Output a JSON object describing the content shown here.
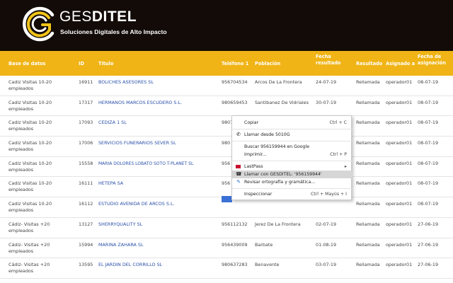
{
  "brand": {
    "name_light": "GES",
    "name_bold": "DITEL",
    "tagline": "Soluciones Digitales de Alto Impacto"
  },
  "columns": [
    {
      "label": "Base de datos"
    },
    {
      "label": "ID"
    },
    {
      "label": "Título"
    },
    {
      "label": "Teléfono 1"
    },
    {
      "label": "Población"
    },
    {
      "label": "Fecha resultado"
    },
    {
      "label": "Resultado"
    },
    {
      "label": "Asignado a"
    },
    {
      "label": "Fecha de asignación"
    }
  ],
  "rows": [
    {
      "base": "Cadiz Visitas 10-20 empleados",
      "id": "16911",
      "titulo": "BOLICHES ASESORES SL",
      "telefono": "956704534",
      "poblacion": "Arcos De La Frontera",
      "fecha_resultado": "24-07-19",
      "resultado": "Rellamada",
      "asignado": "operador01",
      "fecha_asignacion": "08-07-19"
    },
    {
      "base": "Cadiz Visitas 10-20 empleados",
      "id": "17317",
      "titulo": "HERMANOS MARCOS ESCUDERO S.L.",
      "telefono": "980659453",
      "poblacion": "Santibanez De Vidriales",
      "fecha_resultado": "30-07-19",
      "resultado": "Rellamada",
      "asignado": "operador01",
      "fecha_asignacion": "08-07-19"
    },
    {
      "base": "Cadiz Visitas 10-20 empleados",
      "id": "17093",
      "titulo": "CEDIZA 1 SL",
      "telefono": "9807",
      "poblacion": "",
      "fecha_resultado": "",
      "resultado": "Rellamada",
      "asignado": "operador01",
      "fecha_asignacion": "08-07-19"
    },
    {
      "base": "Cadiz Visitas 10-20 empleados",
      "id": "17006",
      "titulo": "SERVICIOS FUNERARIOS SEVER SL",
      "telefono": "980",
      "poblacion": "",
      "fecha_resultado": "",
      "resultado": "Rellamada",
      "asignado": "operador01",
      "fecha_asignacion": "08-07-19"
    },
    {
      "base": "Cadiz Visitas 10-20 empleados",
      "id": "15558",
      "titulo": "MARIA DOLORES LOBATO SOTO T-PLANET SL",
      "telefono": "956",
      "poblacion": "",
      "fecha_resultado": "",
      "resultado": "Rellamada",
      "asignado": "operador01",
      "fecha_asignacion": "08-07-19"
    },
    {
      "base": "Cadiz Visitas 10-20 empleados",
      "id": "16111",
      "titulo": "HETEPA SA",
      "telefono": "956",
      "poblacion": "",
      "fecha_resultado": "",
      "resultado": "Rellamada",
      "asignado": "operador01",
      "fecha_asignacion": "08-07-19"
    },
    {
      "base": "Cadiz Visitas 10-20 empleados",
      "id": "16112",
      "titulo": "ESTUDIO AVENIDA DE ARCOS S.L.",
      "telefono": "956",
      "poblacion": "",
      "fecha_resultado": "",
      "resultado": "Rellamada",
      "asignado": "operador01",
      "fecha_asignacion": "08-07-19"
    },
    {
      "base": "Cádiz- Visitas +20 empleados",
      "id": "13127",
      "titulo": "SHERRYQUALITY SL",
      "telefono": "956112132",
      "poblacion": "Jerez De La Frontera",
      "fecha_resultado": "02-07-19",
      "resultado": "Rellamada",
      "asignado": "operador01",
      "fecha_asignacion": "27-06-19"
    },
    {
      "base": "Cádiz- Visitas +20 empleados",
      "id": "15994",
      "titulo": "MARINA ZAHARA SL",
      "telefono": "956439009",
      "poblacion": "Barbate",
      "fecha_resultado": "01-08-19",
      "resultado": "Rellamada",
      "asignado": "operador01",
      "fecha_asignacion": "27-06-19"
    },
    {
      "base": "Cádiz- Visitas +20 empleados",
      "id": "13595",
      "titulo": "EL JARDIN DEL CORRILLO SL",
      "telefono": "980637283",
      "poblacion": "Benavente",
      "fecha_resultado": "03-07-19",
      "resultado": "Rellamada",
      "asignado": "operador01",
      "fecha_asignacion": "27-06-19"
    }
  ],
  "context_menu": {
    "copy": {
      "label": "Copiar",
      "shortcut": "Ctrl + C"
    },
    "call_device": {
      "label": "Llamar desde 5010G"
    },
    "search_google": {
      "label": "Buscar 956159944 en Google"
    },
    "print": {
      "label": "Imprimir...",
      "shortcut": "Ctrl + P"
    },
    "lastpass": {
      "label": "LastPass"
    },
    "call_gesditel": {
      "label": "Llamar con GESDITEL: '956159944'"
    },
    "spellcheck": {
      "label": "Revisar ortografía y gramática..."
    },
    "inspect": {
      "label": "Inspeccionar",
      "shortcut": "Ctrl + Mayús + I"
    }
  },
  "colors": {
    "header_bg": "#120b08",
    "table_header": "#f0b416",
    "link": "#2a4fa8",
    "logo_yellow": "#f0c419"
  }
}
